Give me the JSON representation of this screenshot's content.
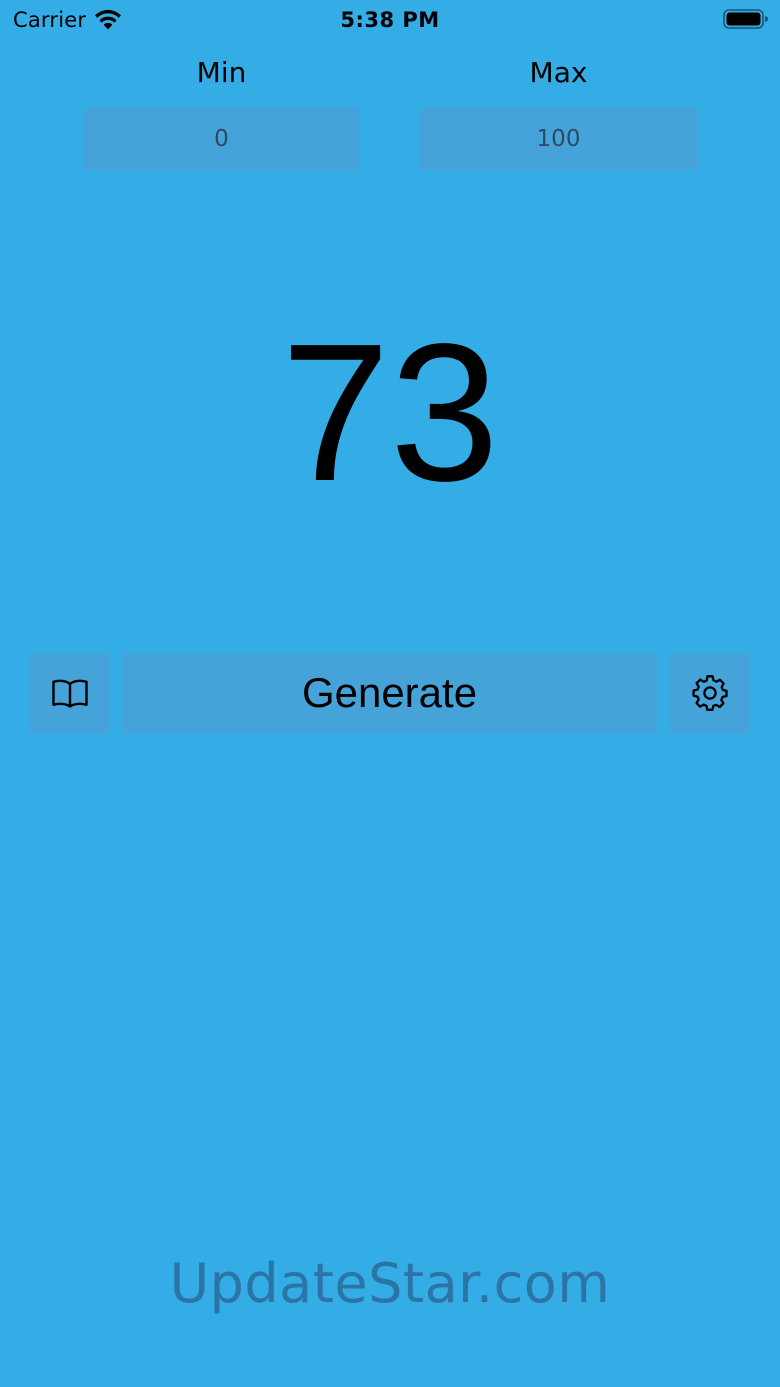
{
  "colors": {
    "background": "#34ace6",
    "control_fill": "#46a3d9",
    "watermark": "#2d74a6"
  },
  "status_bar": {
    "carrier": "Carrier",
    "time": "5:38 PM",
    "wifi_icon": "wifi-icon",
    "battery_icon": "battery-icon"
  },
  "range": {
    "min_label": "Min",
    "max_label": "Max",
    "min_value": "0",
    "max_value": "100"
  },
  "result": {
    "value": "73"
  },
  "actions": {
    "book_icon": "book-icon",
    "generate_label": "Generate",
    "settings_icon": "gear-icon"
  },
  "watermark": {
    "text": "UpdateStar.com"
  }
}
